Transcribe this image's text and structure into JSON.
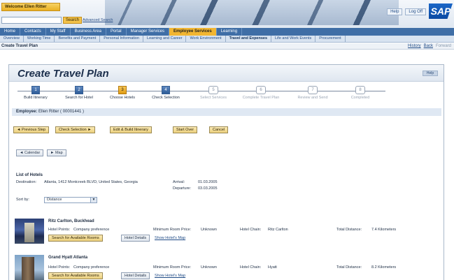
{
  "banner": {
    "welcome": "Welcome Ellen Ritter",
    "search_button": "Search",
    "advanced_search": "Advanced Search",
    "top_links": [
      "Help",
      "Log Off"
    ],
    "logo": "SAP"
  },
  "nav1": {
    "items": [
      "Home",
      "Contacts",
      "My Staff",
      "Business Area",
      "Portal",
      "Manager Services",
      "Employee Services",
      "Learning"
    ],
    "active_index": 6
  },
  "nav2": {
    "items": [
      "Overview",
      "Working Time",
      "Benefits and Payment",
      "Personal Information",
      "Learning and Career",
      "Work Environment",
      "Travel and Expenses",
      "Life and Work Events",
      "Procurement"
    ],
    "active_index": 6
  },
  "pagehead": {
    "title": "Create Travel Plan",
    "history": "History",
    "back": "Back",
    "forward": "Forward"
  },
  "frame": {
    "title": "Create Travel Plan",
    "help": "Help"
  },
  "roadmap": [
    {
      "num": "1",
      "label": "Build Itinerary",
      "state": "done"
    },
    {
      "num": "2",
      "label": "Search for Hotel",
      "state": "done"
    },
    {
      "num": "3",
      "label": "Choose Hotels",
      "state": "current"
    },
    {
      "num": "4",
      "label": "Check Selection",
      "state": "done"
    },
    {
      "num": "5",
      "label": "Select Services",
      "state": "future"
    },
    {
      "num": "6",
      "label": "Complete Travel Plan",
      "state": "future"
    },
    {
      "num": "7",
      "label": "Review and Send",
      "state": "future"
    },
    {
      "num": "8",
      "label": "Completed",
      "state": "future"
    }
  ],
  "employee": {
    "label": "Employee:",
    "value": "Ellen Ritter ( 00001441 )"
  },
  "actions": {
    "previous": "◄ Previous Step",
    "check": "Check Selection ►",
    "edit": "Edit & Build Itinerary",
    "start_over": "Start Over",
    "cancel": "Cancel"
  },
  "view_toggle": {
    "calendar": "◄ Calendar",
    "map": "► Map"
  },
  "hotels_list": {
    "title": "List of Hotels",
    "destination_label": "Destination:",
    "destination_value": "Atlanta, 1412 Montcreek BLVD, United States, Georgia",
    "arrival_label": "Arrival:",
    "arrival_value": "01.03.2005",
    "departure_label": "Departure:",
    "departure_value": "03.03.2005",
    "sort_label": "Sort by:",
    "sort_value": "Distance"
  },
  "hotels": [
    {
      "name": "Ritz Carlton, Buckhead",
      "points_label": "Hotel Points:",
      "points_value": "Company preference",
      "min_price_label": "Minimum Room Price:",
      "min_price_value": "Unknown",
      "chain_label": "Hotel Chain:",
      "chain_value": "Ritz Carlton",
      "distance_label": "Total Distance:",
      "distance_value": "7.4 Kilometers",
      "search_rooms": "Search for Available Rooms",
      "details": "Hotel Details",
      "map_link": "Show Hotel's Map"
    },
    {
      "name": "Grand Hyatt Atlanta",
      "points_label": "Hotel Points:",
      "points_value": "Company preference",
      "min_price_label": "Minimum Room Price:",
      "min_price_value": "Unknown",
      "chain_label": "Hotel Chain:",
      "chain_value": "Hyatt",
      "distance_label": "Total Distance:",
      "distance_value": "8.2 Kilometers",
      "search_rooms": "Search for Available Rooms",
      "details": "Hotel Details",
      "map_link": "Show Hotel's Map"
    }
  ]
}
